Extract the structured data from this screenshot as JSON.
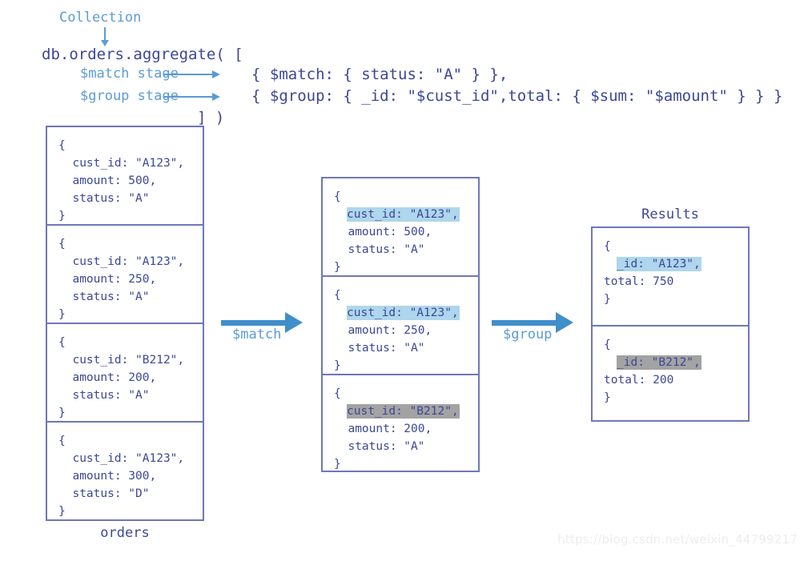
{
  "code": {
    "collection_label": "Collection",
    "line_main": "db.orders.aggregate( [",
    "match_stage_label": "$match stage",
    "group_stage_label": "$group stage",
    "match_stage_code": "{ $match: { status: \"A\" } },",
    "group_stage_code": "{ $group: { _id: \"$cust_id\",total: { $sum: \"$amount\" } } }",
    "line_close": "] )"
  },
  "orders": {
    "caption": "orders",
    "documents": [
      {
        "open": "{",
        "cust_id": "  cust_id: \"A123\",",
        "amount": "  amount: 500,",
        "status": "  status: \"A\"",
        "close": "}"
      },
      {
        "open": "{",
        "cust_id": "  cust_id: \"A123\",",
        "amount": "  amount: 250,",
        "status": "  status: \"A\"",
        "close": "}"
      },
      {
        "open": "{",
        "cust_id": "  cust_id: \"B212\",",
        "amount": "  amount: 200,",
        "status": "  status: \"A\"",
        "close": "}"
      },
      {
        "open": "{",
        "cust_id": "  cust_id: \"A123\",",
        "amount": "  amount: 300,",
        "status": "  status: \"D\"",
        "close": "}"
      }
    ]
  },
  "matched": {
    "documents": [
      {
        "open": "{",
        "cust_id": "cust_id: \"A123\",",
        "highlight": "blue",
        "amount": "  amount: 500,",
        "status": "  status: \"A\"",
        "close": "}"
      },
      {
        "open": "{",
        "cust_id": "cust_id: \"A123\",",
        "highlight": "blue",
        "amount": "  amount: 250,",
        "status": "  status: \"A\"",
        "close": "}"
      },
      {
        "open": "{",
        "cust_id": "cust_id: \"B212\",",
        "highlight": "gray",
        "amount": "  amount: 200,",
        "status": "  status: \"A\"",
        "close": "}"
      }
    ]
  },
  "results": {
    "caption": "Results",
    "documents": [
      {
        "open": "{",
        "id": "_id: \"A123\",",
        "highlight": "blue",
        "total": "total: 750",
        "close": "}"
      },
      {
        "open": "{",
        "id": "_id: \"B212\",",
        "highlight": "gray",
        "total": "total: 200",
        "close": "}"
      }
    ]
  },
  "arrows": {
    "match_label": "$match",
    "group_label": "$group"
  },
  "watermark": "https://blog.csdn.net/weixin_44799217",
  "colors": {
    "code_text": "#3c4795",
    "label_blue": "#5b9bd5",
    "box_border": "#6e77b8",
    "arrow_blue": "#3f8fcb",
    "highlight_blue": "#aed6ec",
    "highlight_gray": "#a3a3a3"
  }
}
